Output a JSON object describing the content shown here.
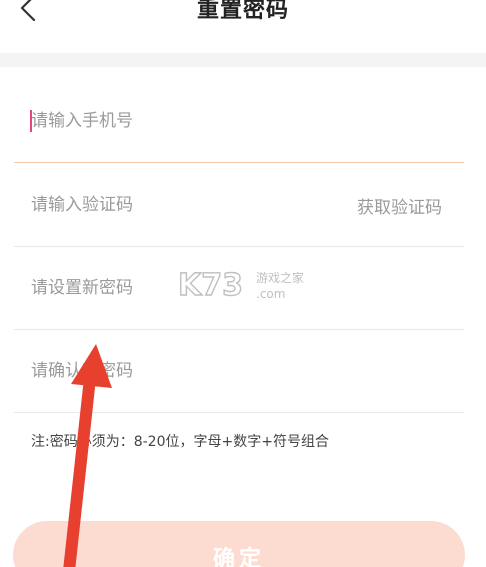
{
  "header": {
    "title": "重置密码",
    "back_icon": "chevron-left-icon"
  },
  "form": {
    "phone_placeholder": "请输入手机号",
    "code_placeholder": "请输入验证码",
    "get_code_label": "获取验证码",
    "new_password_placeholder": "请设置新密码",
    "confirm_password_placeholder": "请确认新密码"
  },
  "note": "注:密码必须为：8-20位，字母+数字+符号组合",
  "confirm_label": "确定",
  "watermark": {
    "brand": "K73",
    "tagline": "游戏之家",
    "domain": ".com"
  },
  "colors": {
    "accent_line": "#f3c7aa",
    "caret": "#e9457c",
    "button_bg": "#fcdcd0",
    "annotation_arrow": "#e8402f"
  }
}
